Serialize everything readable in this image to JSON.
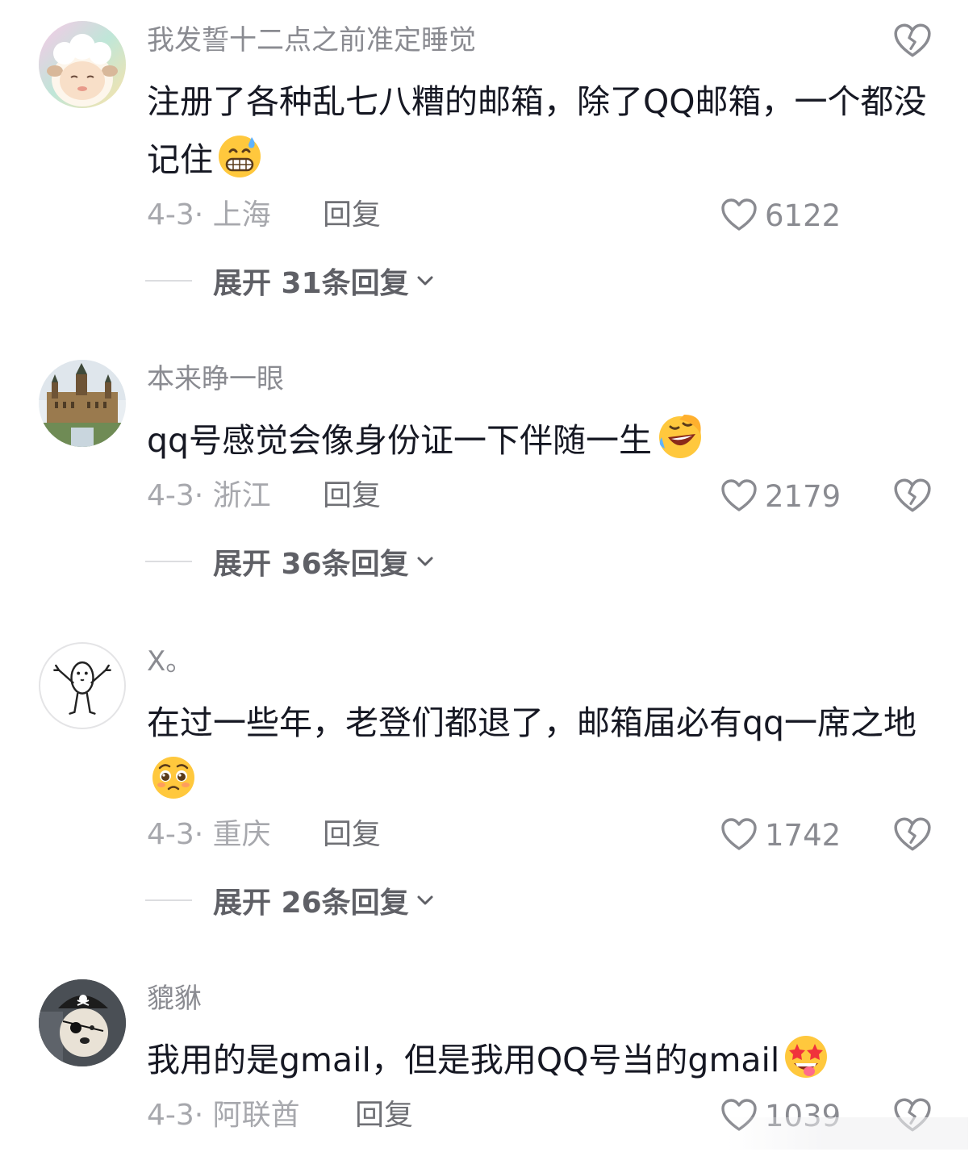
{
  "comments": [
    {
      "username": "我发誓十二点之前准定睡觉",
      "text": "注册了各种乱七八糟的邮箱，除了QQ邮箱，一个都没记住",
      "emoji": "grin-sweat-emoji",
      "date_location": "4-3· 上海",
      "reply_label": "回复",
      "likes": "6122",
      "expand_label": "展开 31条回复"
    },
    {
      "username": "本来睁一眼",
      "text": "qq号感觉会像身份证一下伴随一生",
      "emoji": "rolling-laugh-emoji",
      "date_location": "4-3· 浙江",
      "reply_label": "回复",
      "likes": "2179",
      "expand_label": "展开 36条回复"
    },
    {
      "username": "X。",
      "text": "在过一些年，老登们都退了，邮箱届必有qq一席之地",
      "emoji": "pleading-emoji",
      "date_location": "4-3· 重庆",
      "reply_label": "回复",
      "likes": "1742",
      "expand_label": "展开 26条回复"
    },
    {
      "username": "貔貅",
      "text": "我用的是gmail，但是我用QQ号当的gmail",
      "emoji": "star-struck-emoji",
      "date_location": "4-3· 阿联酋",
      "reply_label": "回复",
      "likes": "1039"
    }
  ],
  "colors": {
    "text": "#161823",
    "meta": "#a7a8ad",
    "username": "#8a8b91",
    "emoji_yellow": "#ffc83d"
  }
}
